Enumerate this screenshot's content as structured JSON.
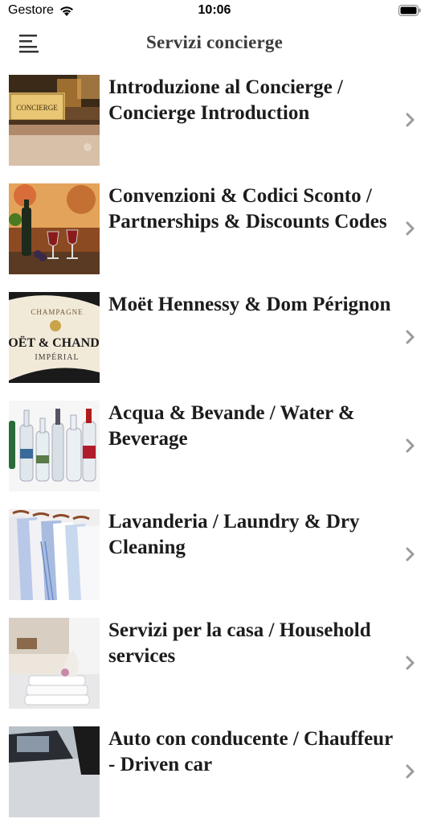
{
  "status": {
    "carrier": "Gestore",
    "time": "10:06"
  },
  "nav": {
    "title": "Servizi concierge"
  },
  "items": [
    {
      "label": "Introduzione al Concierge / Concierge Introduction",
      "thumb_text": "CONCIERGE"
    },
    {
      "label": "Convenzioni & Codici Sconto / Partnerships & Discounts Codes"
    },
    {
      "label": "Moët Hennessy & Dom Pérignon",
      "thumb_text_1": "CHAMPAGNE",
      "thumb_text_2": "OËT & CHAND",
      "thumb_text_3": "IMPÉRIAL"
    },
    {
      "label": "Acqua & Bevande / Water & Beverage"
    },
    {
      "label": "Lavanderia / Laundry & Dry Cleaning"
    },
    {
      "label": "Servizi per la casa / Household services"
    },
    {
      "label": "Auto con conducente / Chauffeur - Driven car"
    }
  ],
  "colors": {
    "title": "#3c3c3c",
    "chevron": "#9b9b9b"
  }
}
